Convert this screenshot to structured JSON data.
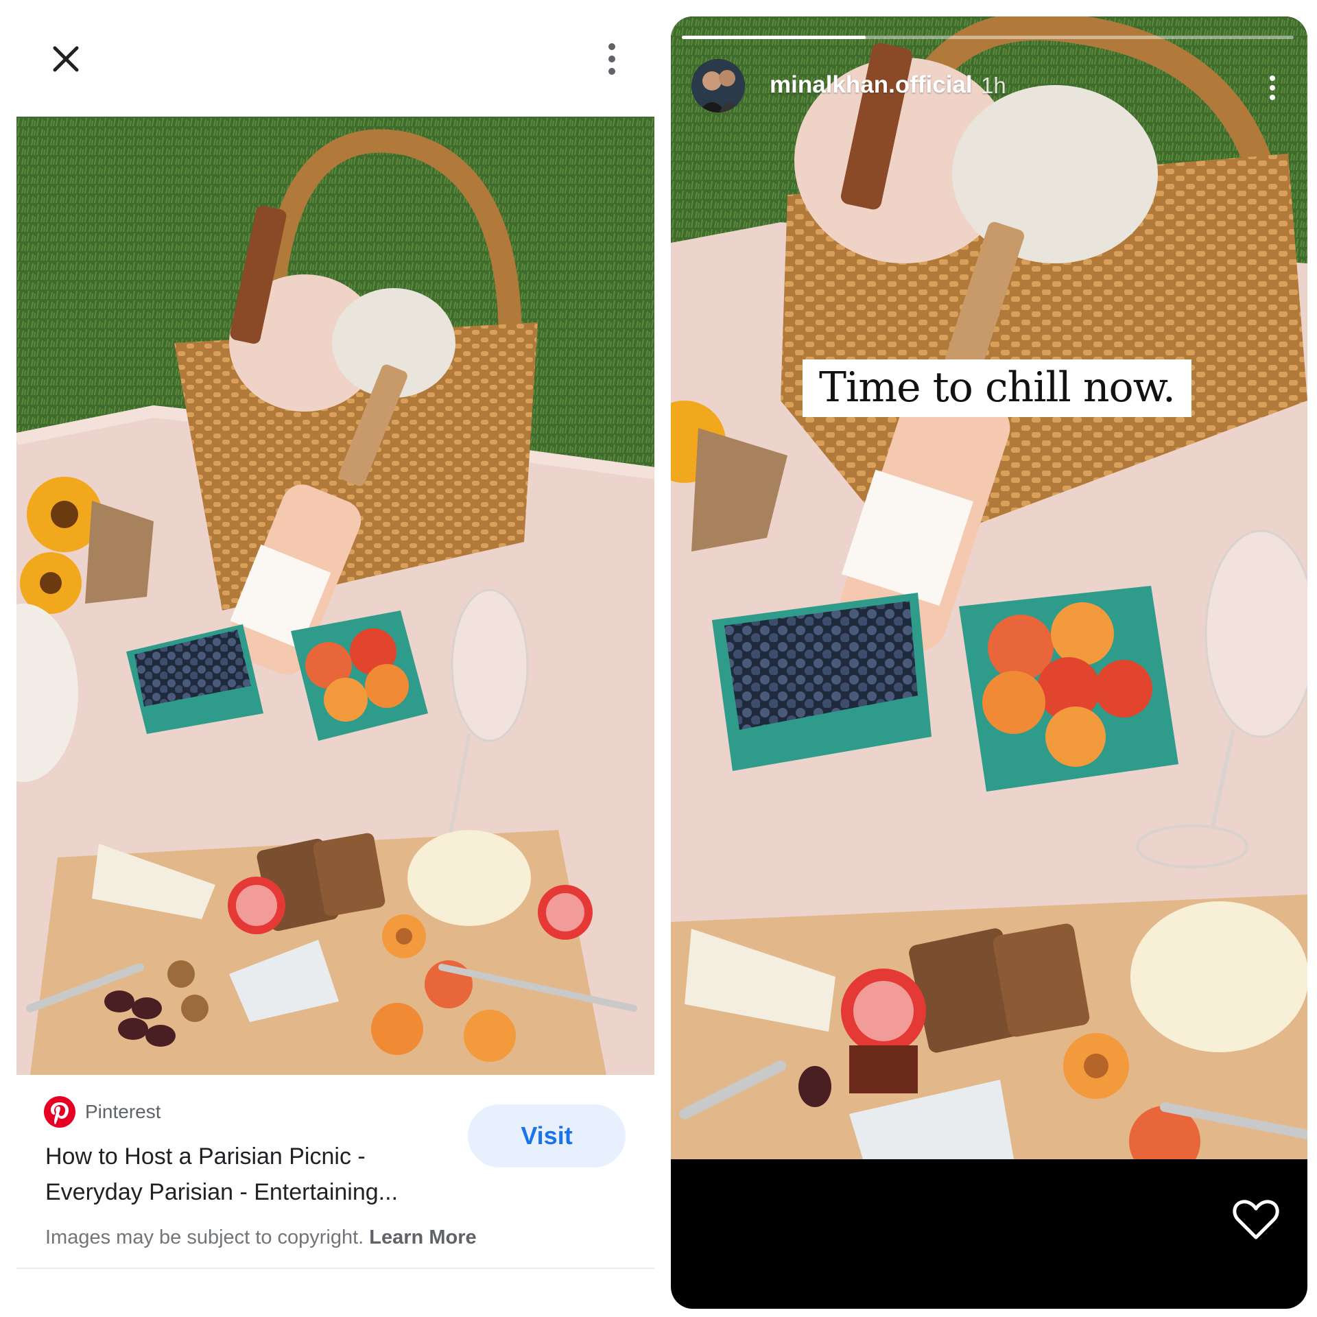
{
  "google_viewer": {
    "close_icon": "close-icon",
    "more_icon": "more-vert-icon",
    "source": {
      "icon": "pinterest-icon",
      "name": "Pinterest",
      "brand_color": "#e60023"
    },
    "title": "How to Host a Parisian Picnic - Everyday Parisian - Entertaining...",
    "visit_label": "Visit",
    "copyright_text": "Images may be subject to copyright.",
    "learn_more_label": "Learn More"
  },
  "story": {
    "username": "minalkhan.official",
    "time": "1h",
    "progress": 0.3,
    "caption": "Time to chill now.",
    "more_icon": "more-vert-icon",
    "like_icon": "heart-outline-icon"
  },
  "colors": {
    "accent": "#1a73e8",
    "visit_bg": "#e8f0fe",
    "story_bg": "#000000"
  }
}
